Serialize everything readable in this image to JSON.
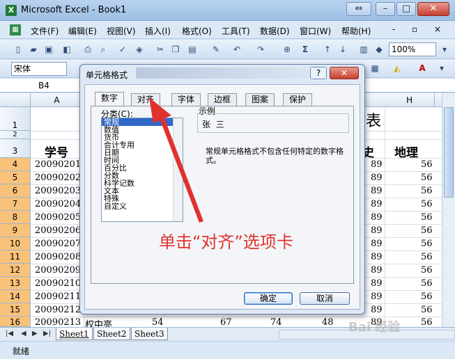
{
  "window": {
    "title": "Microsoft Excel - Book1",
    "app_icon_glyph": "X",
    "restore_glyph": "⇔",
    "min_glyph": "–",
    "max_glyph": "□",
    "close_glyph": "✕"
  },
  "menubar": {
    "items": [
      "文件(F)",
      "编辑(E)",
      "视图(V)",
      "插入(I)",
      "格式(O)",
      "工具(T)",
      "数据(D)",
      "窗口(W)",
      "帮助(H)"
    ],
    "doc_controls": "- ▫ ×"
  },
  "toolbar": {
    "zoom": "100%"
  },
  "formatbar": {
    "font": "宋体"
  },
  "namebox": {
    "value": "B4"
  },
  "columns": [
    "A",
    "H"
  ],
  "rows": [
    "1",
    "2",
    "3",
    "4",
    "5",
    "6",
    "7",
    "8",
    "9",
    "10",
    "11",
    "12",
    "13",
    "14",
    "15",
    "16"
  ],
  "sheet": {
    "title_fragment": "表",
    "header_partial": "史",
    "header_a": "学号",
    "header_h": "地理",
    "ids": [
      "20090201",
      "20090202",
      "20090203",
      "20090204",
      "20090205",
      "20090206",
      "20090207",
      "20090208",
      "20090209",
      "20090210",
      "20090211",
      "20090212",
      "20090213"
    ],
    "g_values": [
      "89",
      "89",
      "89",
      "89",
      "89",
      "89",
      "89",
      "89",
      "89",
      "89",
      "89",
      "89",
      "89"
    ],
    "h_values": [
      "56",
      "56",
      "56",
      "56",
      "56",
      "56",
      "56",
      "56",
      "56",
      "56",
      "56",
      "56",
      "56"
    ],
    "row16": {
      "name": "权中亮",
      "c": "54",
      "d": "67",
      "e": "74",
      "f": "48"
    }
  },
  "sheet_tabs": [
    "Sheet1",
    "Sheet2",
    "Sheet3"
  ],
  "status": {
    "text": "就绪"
  },
  "dialog": {
    "title": "单元格格式",
    "help": "?",
    "close": "✕",
    "tabs": [
      "数字",
      "对齐",
      "字体",
      "边框",
      "图案",
      "保护"
    ],
    "category_label": "分类(C):",
    "categories": [
      "常规",
      "数值",
      "货币",
      "会计专用",
      "日期",
      "时间",
      "百分比",
      "分数",
      "科学记数",
      "文本",
      "特殊",
      "自定义"
    ],
    "sample_label": "示例",
    "sample_value": "张 三",
    "description": "常规单元格格式不包含任何特定的数字格式。",
    "ok": "确定",
    "cancel": "取消"
  },
  "annotation": {
    "text": "单击“对齐”选项卡",
    "color": "#e0312c"
  },
  "watermark": {
    "text": "Bai 经验"
  }
}
